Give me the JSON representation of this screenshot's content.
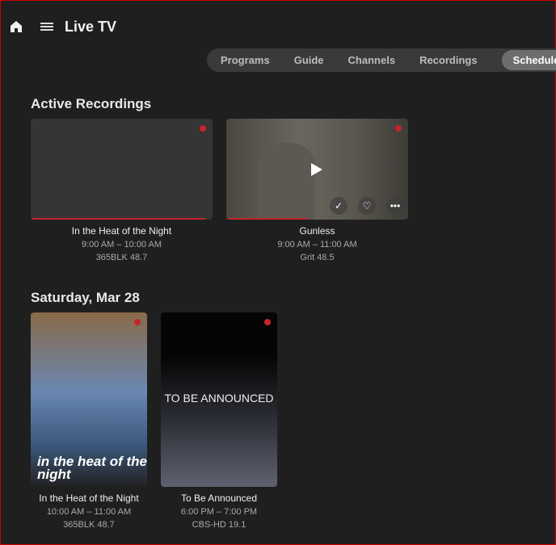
{
  "header": {
    "title": "Live TV",
    "icons": [
      "home-icon",
      "menu-icon"
    ]
  },
  "tabs": [
    {
      "label": "Programs"
    },
    {
      "label": "Guide"
    },
    {
      "label": "Channels"
    },
    {
      "label": "Recordings"
    },
    {
      "label": "Schedule",
      "active": true
    }
  ],
  "sections": [
    {
      "title": "Active Recordings",
      "items": [
        {
          "title": "In the Heat of the Night",
          "time": "9:00 AM – 10:00 AM",
          "channel": "365BLK 48.7",
          "progress": 0.96
        },
        {
          "title": "Gunless",
          "time": "9:00 AM – 11:00 AM",
          "channel": "Grit 48.5",
          "progress": 0.45
        }
      ]
    },
    {
      "title": "Saturday, Mar 28",
      "items": [
        {
          "title": "In the Heat of the Night",
          "time": "10:00 AM – 11:00 AM",
          "channel": "365BLK 48.7",
          "poster_text": "in the heat of the night"
        },
        {
          "title": "To Be Announced",
          "time": "6:00 PM – 7:00 PM",
          "channel": "CBS-HD 19.1",
          "poster_text": "TO BE ANNOUNCED"
        }
      ]
    }
  ],
  "colors": {
    "accent": "#c8232c",
    "background": "#1f1f1f"
  }
}
